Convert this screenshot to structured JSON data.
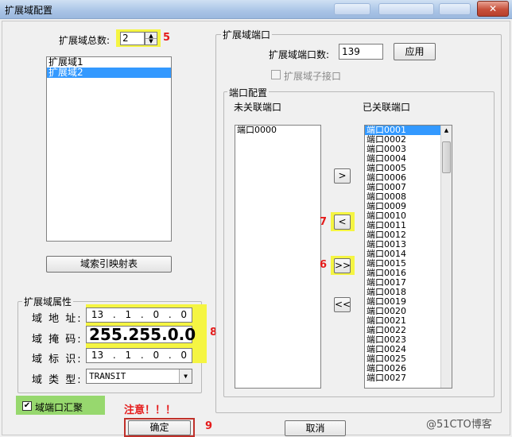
{
  "window": {
    "title": "扩展域配置",
    "close_glyph": "✕"
  },
  "left": {
    "total_label": "扩展域总数:",
    "total_value": "2",
    "domains": [
      "扩展域1",
      "扩展域2"
    ],
    "selected_domain_index": 1,
    "index_map_button": "域索引映射表",
    "attr_group_label": "扩展域属性",
    "addr_label": "域 地 址:",
    "addr_octets": [
      "13",
      "1",
      "0",
      "0"
    ],
    "mask_label": "域 掩 码:",
    "mask_value": "255.255.0.0",
    "id_label": "域 标 识:",
    "id_octets": [
      "13",
      "1",
      "0",
      "0"
    ],
    "type_label": "域 类 型:",
    "type_value": "TRANSIT",
    "aggregate_label": "域端口汇聚",
    "aggregate_checked": true
  },
  "right": {
    "group_label": "扩展域端口",
    "port_count_label": "扩展域端口数:",
    "port_count_value": "139",
    "apply_button": "应用",
    "subinterface_label": "扩展域子接口",
    "port_config_label": "端口配置",
    "unassoc_label": "未关联端口",
    "assoc_label": "已关联端口",
    "unassoc_ports": [
      "端口0000"
    ],
    "assoc_ports": [
      "端口0001",
      "端口0002",
      "端口0003",
      "端口0004",
      "端口0005",
      "端口0006",
      "端口0007",
      "端口0008",
      "端口0009",
      "端口0010",
      "端口0011",
      "端口0012",
      "端口0013",
      "端口0014",
      "端口0015",
      "端口0016",
      "端口0017",
      "端口0018",
      "端口0019",
      "端口0020",
      "端口0021",
      "端口0022",
      "端口0023",
      "端口0024",
      "端口0025",
      "端口0026",
      "端口0027"
    ],
    "move_right": ">",
    "move_left": "<",
    "move_all_right": ">>",
    "move_all_left": "<<"
  },
  "annotations": {
    "n5": "5",
    "n6": "6",
    "n7": "7",
    "n8": "8",
    "n9": "9",
    "note": "注意！！！"
  },
  "footer": {
    "ok_button": "确定",
    "cancel_button": "取消"
  },
  "watermark": "@51CTO博客",
  "colors": {
    "highlight": "#f5f542",
    "annotation_red": "#e51b1b",
    "selection": "#3399ff"
  }
}
